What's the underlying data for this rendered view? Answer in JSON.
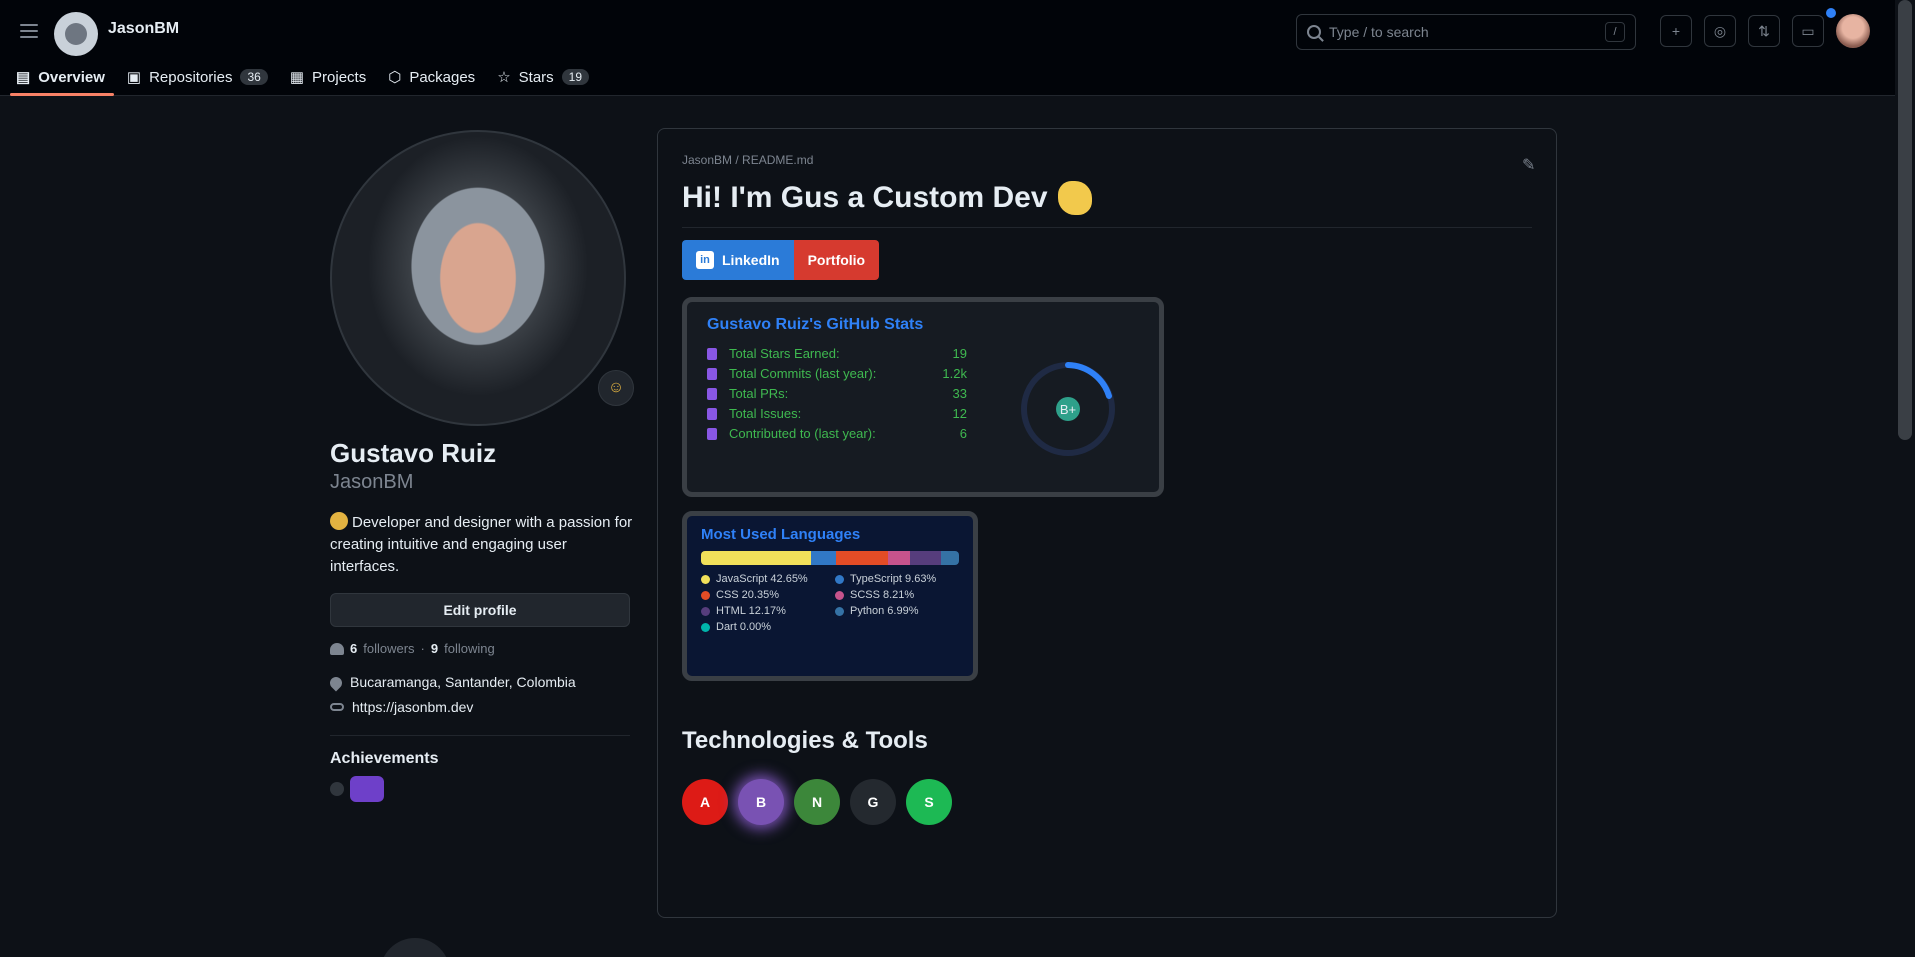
{
  "header": {
    "username": "JasonBM",
    "search_placeholder": "Type / to search",
    "search_key": "/",
    "icons": [
      "plus-icon",
      "issues-icon",
      "pulls-icon",
      "inbox-icon"
    ]
  },
  "tabs": [
    {
      "label": "Overview",
      "count": ""
    },
    {
      "label": "Repositories",
      "count": "36"
    },
    {
      "label": "Projects",
      "count": ""
    },
    {
      "label": "Packages",
      "count": ""
    },
    {
      "label": "Stars",
      "count": "19"
    }
  ],
  "profile": {
    "fullname": "Gustavo Ruiz",
    "login": "JasonBM",
    "bio": "Developer and designer with a passion for creating intuitive and engaging user interfaces.",
    "edit_label": "Edit profile",
    "followers": "6",
    "followers_label": "followers",
    "following": "9",
    "following_label": "following",
    "location": "Bucaramanga, Santander, Colombia",
    "website": "https://jasonbm.dev",
    "achievements_title": "Achievements"
  },
  "readme": {
    "path": "JasonBM / README.md",
    "title": "Hi! I'm Gus a Custom Dev",
    "shield_left": "LinkedIn",
    "shield_right": "Portfolio",
    "stats": {
      "title": "Gustavo Ruiz's GitHub Stats",
      "rows": [
        {
          "label": "Total Stars Earned:",
          "value": "19"
        },
        {
          "label": "Total Commits (last year):",
          "value": "1.2k"
        },
        {
          "label": "Total PRs:",
          "value": "33"
        },
        {
          "label": "Total Issues:",
          "value": "12"
        },
        {
          "label": "Contributed to (last year):",
          "value": "6"
        }
      ],
      "grade": "B+"
    },
    "langs": {
      "title": "Most Used Languages",
      "items": [
        {
          "name": "JavaScript 42.65%",
          "color": "#f1e05a",
          "pct": 42.65
        },
        {
          "name": "TypeScript 9.63%",
          "color": "#3178c6",
          "pct": 9.63
        },
        {
          "name": "CSS 20.35%",
          "color": "#e34c26",
          "pct": 20.35
        },
        {
          "name": "SCSS 8.21%",
          "color": "#c6538c",
          "pct": 8.21
        },
        {
          "name": "HTML 12.17%",
          "color": "#563d7c",
          "pct": 12.17
        },
        {
          "name": "Python 6.99%",
          "color": "#3572a5",
          "pct": 6.99
        },
        {
          "name": "Dart 0.00%",
          "color": "#00b4ab",
          "pct": 0
        }
      ]
    },
    "tech_title": "Technologies & Tools",
    "tech": [
      {
        "name": "angular-icon",
        "label": "A",
        "color": "#dd1b16"
      },
      {
        "name": "bootstrap-icon",
        "label": "B",
        "color": "#7952b3"
      },
      {
        "name": "nodejs-icon",
        "label": "N",
        "color": "#3c873a"
      },
      {
        "name": "github-icon",
        "label": "G",
        "color": "#24292f"
      },
      {
        "name": "spotify-icon",
        "label": "S",
        "color": "#1db954"
      }
    ]
  }
}
